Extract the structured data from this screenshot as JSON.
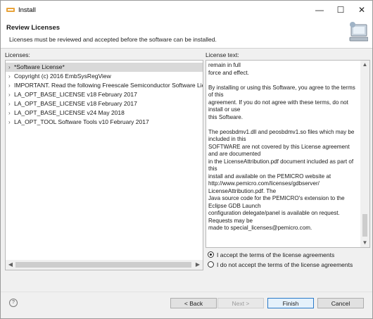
{
  "window": {
    "title": "Install",
    "minimize_glyph": "—",
    "maximize_glyph": "☐",
    "close_glyph": "✕",
    "icon": "eclipse-install-icon"
  },
  "header": {
    "title": "Review Licenses",
    "subtitle": "Licenses must be reviewed and accepted before the software can be installed.",
    "image": "computer-install-icon"
  },
  "licenses": {
    "label": "Licenses:",
    "items": [
      {
        "label": "*Software License*",
        "selected": true
      },
      {
        "label": "Copyright (c) 2016 EmbSysRegView",
        "selected": false
      },
      {
        "label": "IMPORTANT.  Read the following Freescale Semiconductor Software License Ag",
        "selected": false
      },
      {
        "label": "LA_OPT_BASE_LICENSE v18 February 2017",
        "selected": false
      },
      {
        "label": "LA_OPT_BASE_LICENSE v18 February 2017",
        "selected": false
      },
      {
        "label": "LA_OPT_BASE_LICENSE v24 May 2018",
        "selected": false
      },
      {
        "label": "LA_OPT_TOOL Software Tools v10 February 2017",
        "selected": false
      }
    ]
  },
  "license_text": {
    "label": "License text:",
    "content": "remain in full\nforce and effect.\n\nBy installing or using this Software, you agree to the terms of this\nagreement.  If you do not agree with these terms, do not install or use\nthis Software.\n\nThe peosbdmv1.dll and peosbdmv1.so files which may be included in this\nSOFTWARE are not covered by this License agreement and are documented\nin the LicenseAttribution.pdf document included as part of this\ninstall and available on the PEMICRO website at\nhttp://www.pemicro.com/licenses/gdbserver/\nLicenseAttribution.pdf. The\nJava source code for the PEMICRO's extension to the Eclipse GDB Launch\nconfiguration delegate/panel is available on request.  Requests may be\nmade to special_licenses@pemicro.com."
  },
  "agreement": {
    "accept_label": "I accept the terms of the license agreements",
    "decline_label": "I do not accept the terms of the license agreements",
    "selected": "accept"
  },
  "footer": {
    "help_glyph": "?",
    "back_label": "< Back",
    "next_label": "Next >",
    "finish_label": "Finish",
    "cancel_label": "Cancel"
  }
}
